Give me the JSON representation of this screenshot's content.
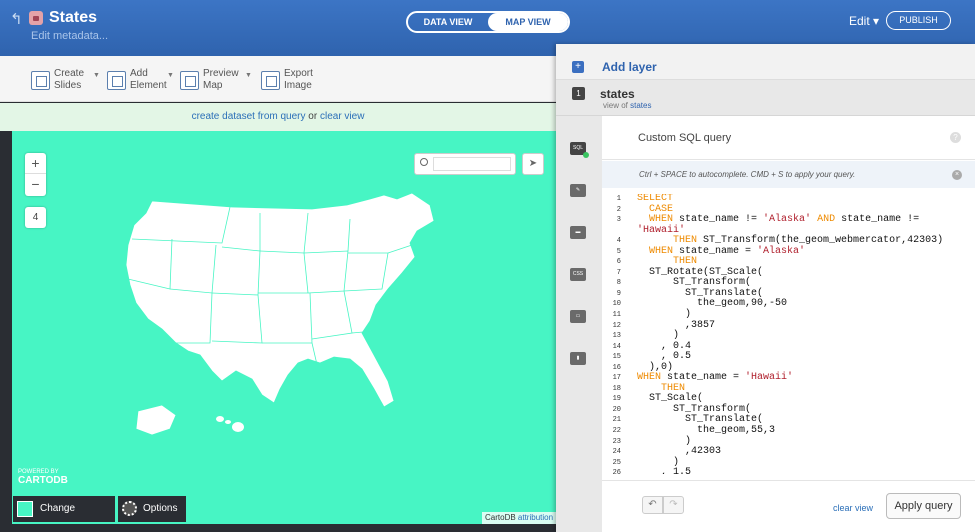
{
  "header": {
    "title": "States",
    "edit_metadata": "Edit metadata...",
    "view_toggle": [
      "DATA VIEW",
      "MAP VIEW"
    ],
    "active_view": "MAP VIEW",
    "edit_menu": "Edit ▾",
    "publish": "PUBLISH"
  },
  "toolbar": {
    "create_slides": "Create\nSlides",
    "add_element": "Add\nElement",
    "preview_map": "Preview\nMap",
    "export_image": "Export\nImage"
  },
  "notice": {
    "create_link": "create dataset from query",
    "or": " or ",
    "clear_link": "clear view"
  },
  "map": {
    "zoom_in": "+",
    "zoom_out": "−",
    "zoom_level": "4",
    "logo_small": "POWERED BY",
    "logo": "CARTODB",
    "change_basemap": "Change basemap",
    "options": "Options",
    "attribution_prefix": "CartoDB ",
    "attribution_link": "attribution",
    "basemap_color": "#47f5c4"
  },
  "panel": {
    "add_layer": "Add layer",
    "layer_number": "1",
    "layer_name": "states",
    "view_of_prefix": "view of ",
    "view_of_table": "states",
    "tabs": [
      "SQL",
      "wizard-icon",
      "infowindow-icon",
      "CSS",
      "legend-icon",
      "chart-icon"
    ],
    "sql_title": "Custom SQL query",
    "help": "?",
    "hint": "Ctrl + SPACE to autocomplete. CMD + S to apply your query.",
    "hint_close": "×",
    "clear_view": "clear view",
    "apply_query": "Apply query"
  },
  "code_lines": [
    {
      "n": "1",
      "html": "<span class=\"kw\">SELECT</span>"
    },
    {
      "n": "2",
      "html": "  <span class=\"kw\">CASE</span>"
    },
    {
      "n": "3",
      "html": "  <span class=\"kw\">WHEN</span> state_name != <span class=\"str\">'Alaska'</span> <span class=\"kw\">AND</span> state_name !="
    },
    {
      "n": "",
      "html": "<span class=\"str\">'Hawaii'</span>"
    },
    {
      "n": "4",
      "html": "      <span class=\"kw\">THEN</span> ST_Transform(the_geom_webmercator,42303)"
    },
    {
      "n": "5",
      "html": "  <span class=\"kw\">WHEN</span> state_name = <span class=\"str\">'Alaska'</span>"
    },
    {
      "n": "6",
      "html": "      <span class=\"kw\">THEN</span>"
    },
    {
      "n": "7",
      "html": "  ST_Rotate(ST_Scale("
    },
    {
      "n": "8",
      "html": "      ST_Transform("
    },
    {
      "n": "9",
      "html": "        ST_Translate("
    },
    {
      "n": "10",
      "html": "          the_geom,90,-50"
    },
    {
      "n": "11",
      "html": "        )"
    },
    {
      "n": "12",
      "html": "        ,3857"
    },
    {
      "n": "13",
      "html": "      )"
    },
    {
      "n": "14",
      "html": "    , 0.4"
    },
    {
      "n": "15",
      "html": "    , 0.5"
    },
    {
      "n": "16",
      "html": "  ),0)"
    },
    {
      "n": "17",
      "html": "<span class=\"kw\">WHEN</span> state_name = <span class=\"str\">'Hawaii'</span>"
    },
    {
      "n": "18",
      "html": "    <span class=\"kw\">THEN</span>"
    },
    {
      "n": "19",
      "html": "  ST_Scale("
    },
    {
      "n": "20",
      "html": "      ST_Transform("
    },
    {
      "n": "21",
      "html": "        ST_Translate("
    },
    {
      "n": "22",
      "html": "          the_geom,55,3"
    },
    {
      "n": "23",
      "html": "        )"
    },
    {
      "n": "24",
      "html": "        ,42303"
    },
    {
      "n": "25",
      "html": "      )"
    },
    {
      "n": "26",
      "html": "    , 1.5"
    }
  ]
}
